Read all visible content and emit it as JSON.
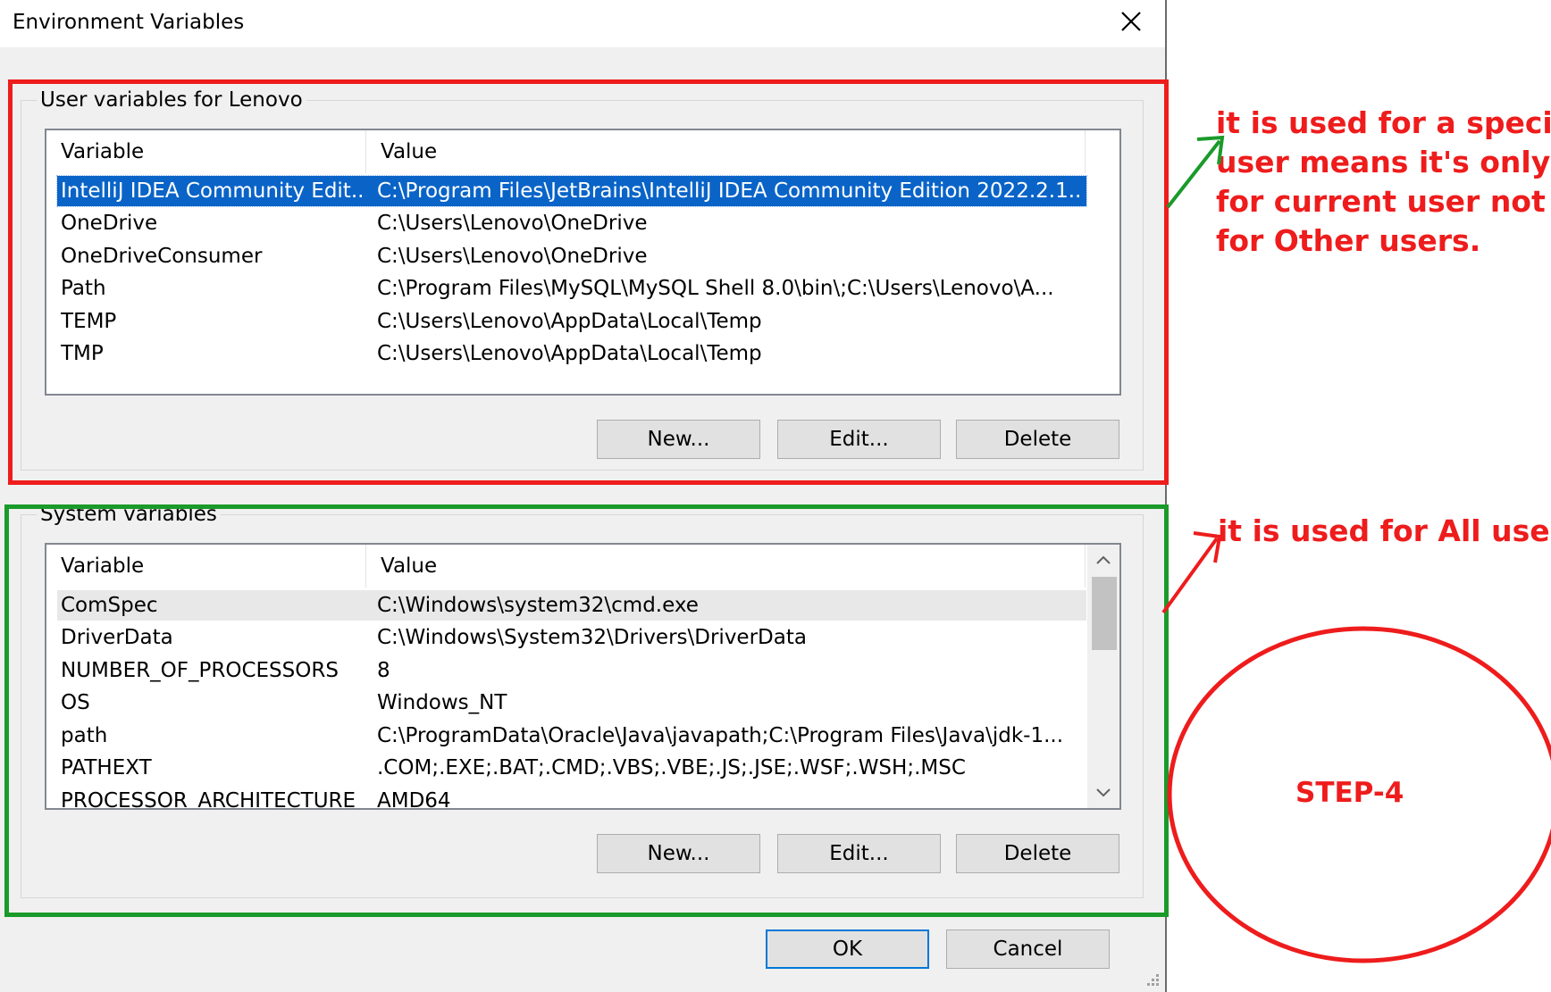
{
  "dialog": {
    "title": "Environment Variables",
    "ok_label": "OK",
    "cancel_label": "Cancel"
  },
  "user_vars": {
    "group_label": "User variables for Lenovo",
    "columns": [
      "Variable",
      "Value"
    ],
    "rows": [
      {
        "variable": "IntelliJ IDEA Community Edit...",
        "value": "C:\\Program Files\\JetBrains\\IntelliJ IDEA Community Edition 2022.2.1..."
      },
      {
        "variable": "OneDrive",
        "value": "C:\\Users\\Lenovo\\OneDrive"
      },
      {
        "variable": "OneDriveConsumer",
        "value": "C:\\Users\\Lenovo\\OneDrive"
      },
      {
        "variable": "Path",
        "value": "C:\\Program Files\\MySQL\\MySQL Shell 8.0\\bin\\;C:\\Users\\Lenovo\\A..."
      },
      {
        "variable": "TEMP",
        "value": "C:\\Users\\Lenovo\\AppData\\Local\\Temp"
      },
      {
        "variable": "TMP",
        "value": "C:\\Users\\Lenovo\\AppData\\Local\\Temp"
      }
    ],
    "new_label": "New...",
    "edit_label": "Edit...",
    "delete_label": "Delete"
  },
  "system_vars": {
    "group_label": "System variables",
    "columns": [
      "Variable",
      "Value"
    ],
    "rows": [
      {
        "variable": "ComSpec",
        "value": "C:\\Windows\\system32\\cmd.exe"
      },
      {
        "variable": "DriverData",
        "value": "C:\\Windows\\System32\\Drivers\\DriverData"
      },
      {
        "variable": "NUMBER_OF_PROCESSORS",
        "value": "8"
      },
      {
        "variable": "OS",
        "value": "Windows_NT"
      },
      {
        "variable": "path",
        "value": "C:\\ProgramData\\Oracle\\Java\\javapath;C:\\Program Files\\Java\\jdk-1..."
      },
      {
        "variable": "PATHEXT",
        "value": ".COM;.EXE;.BAT;.CMD;.VBS;.VBE;.JS;.JSE;.WSF;.WSH;.MSC"
      },
      {
        "variable": "PROCESSOR_ARCHITECTURE",
        "value": "AMD64"
      }
    ],
    "new_label": "New...",
    "edit_label": "Edit...",
    "delete_label": "Delete"
  },
  "annotations": {
    "user_note_lines": [
      "it is used for a specific",
      "user means it's only",
      "for current user not",
      "for Other users."
    ],
    "system_note": "it is used for All users",
    "step_label": "STEP-4",
    "colors": {
      "red": "#ee1c1c",
      "green": "#1a9a2a"
    }
  }
}
